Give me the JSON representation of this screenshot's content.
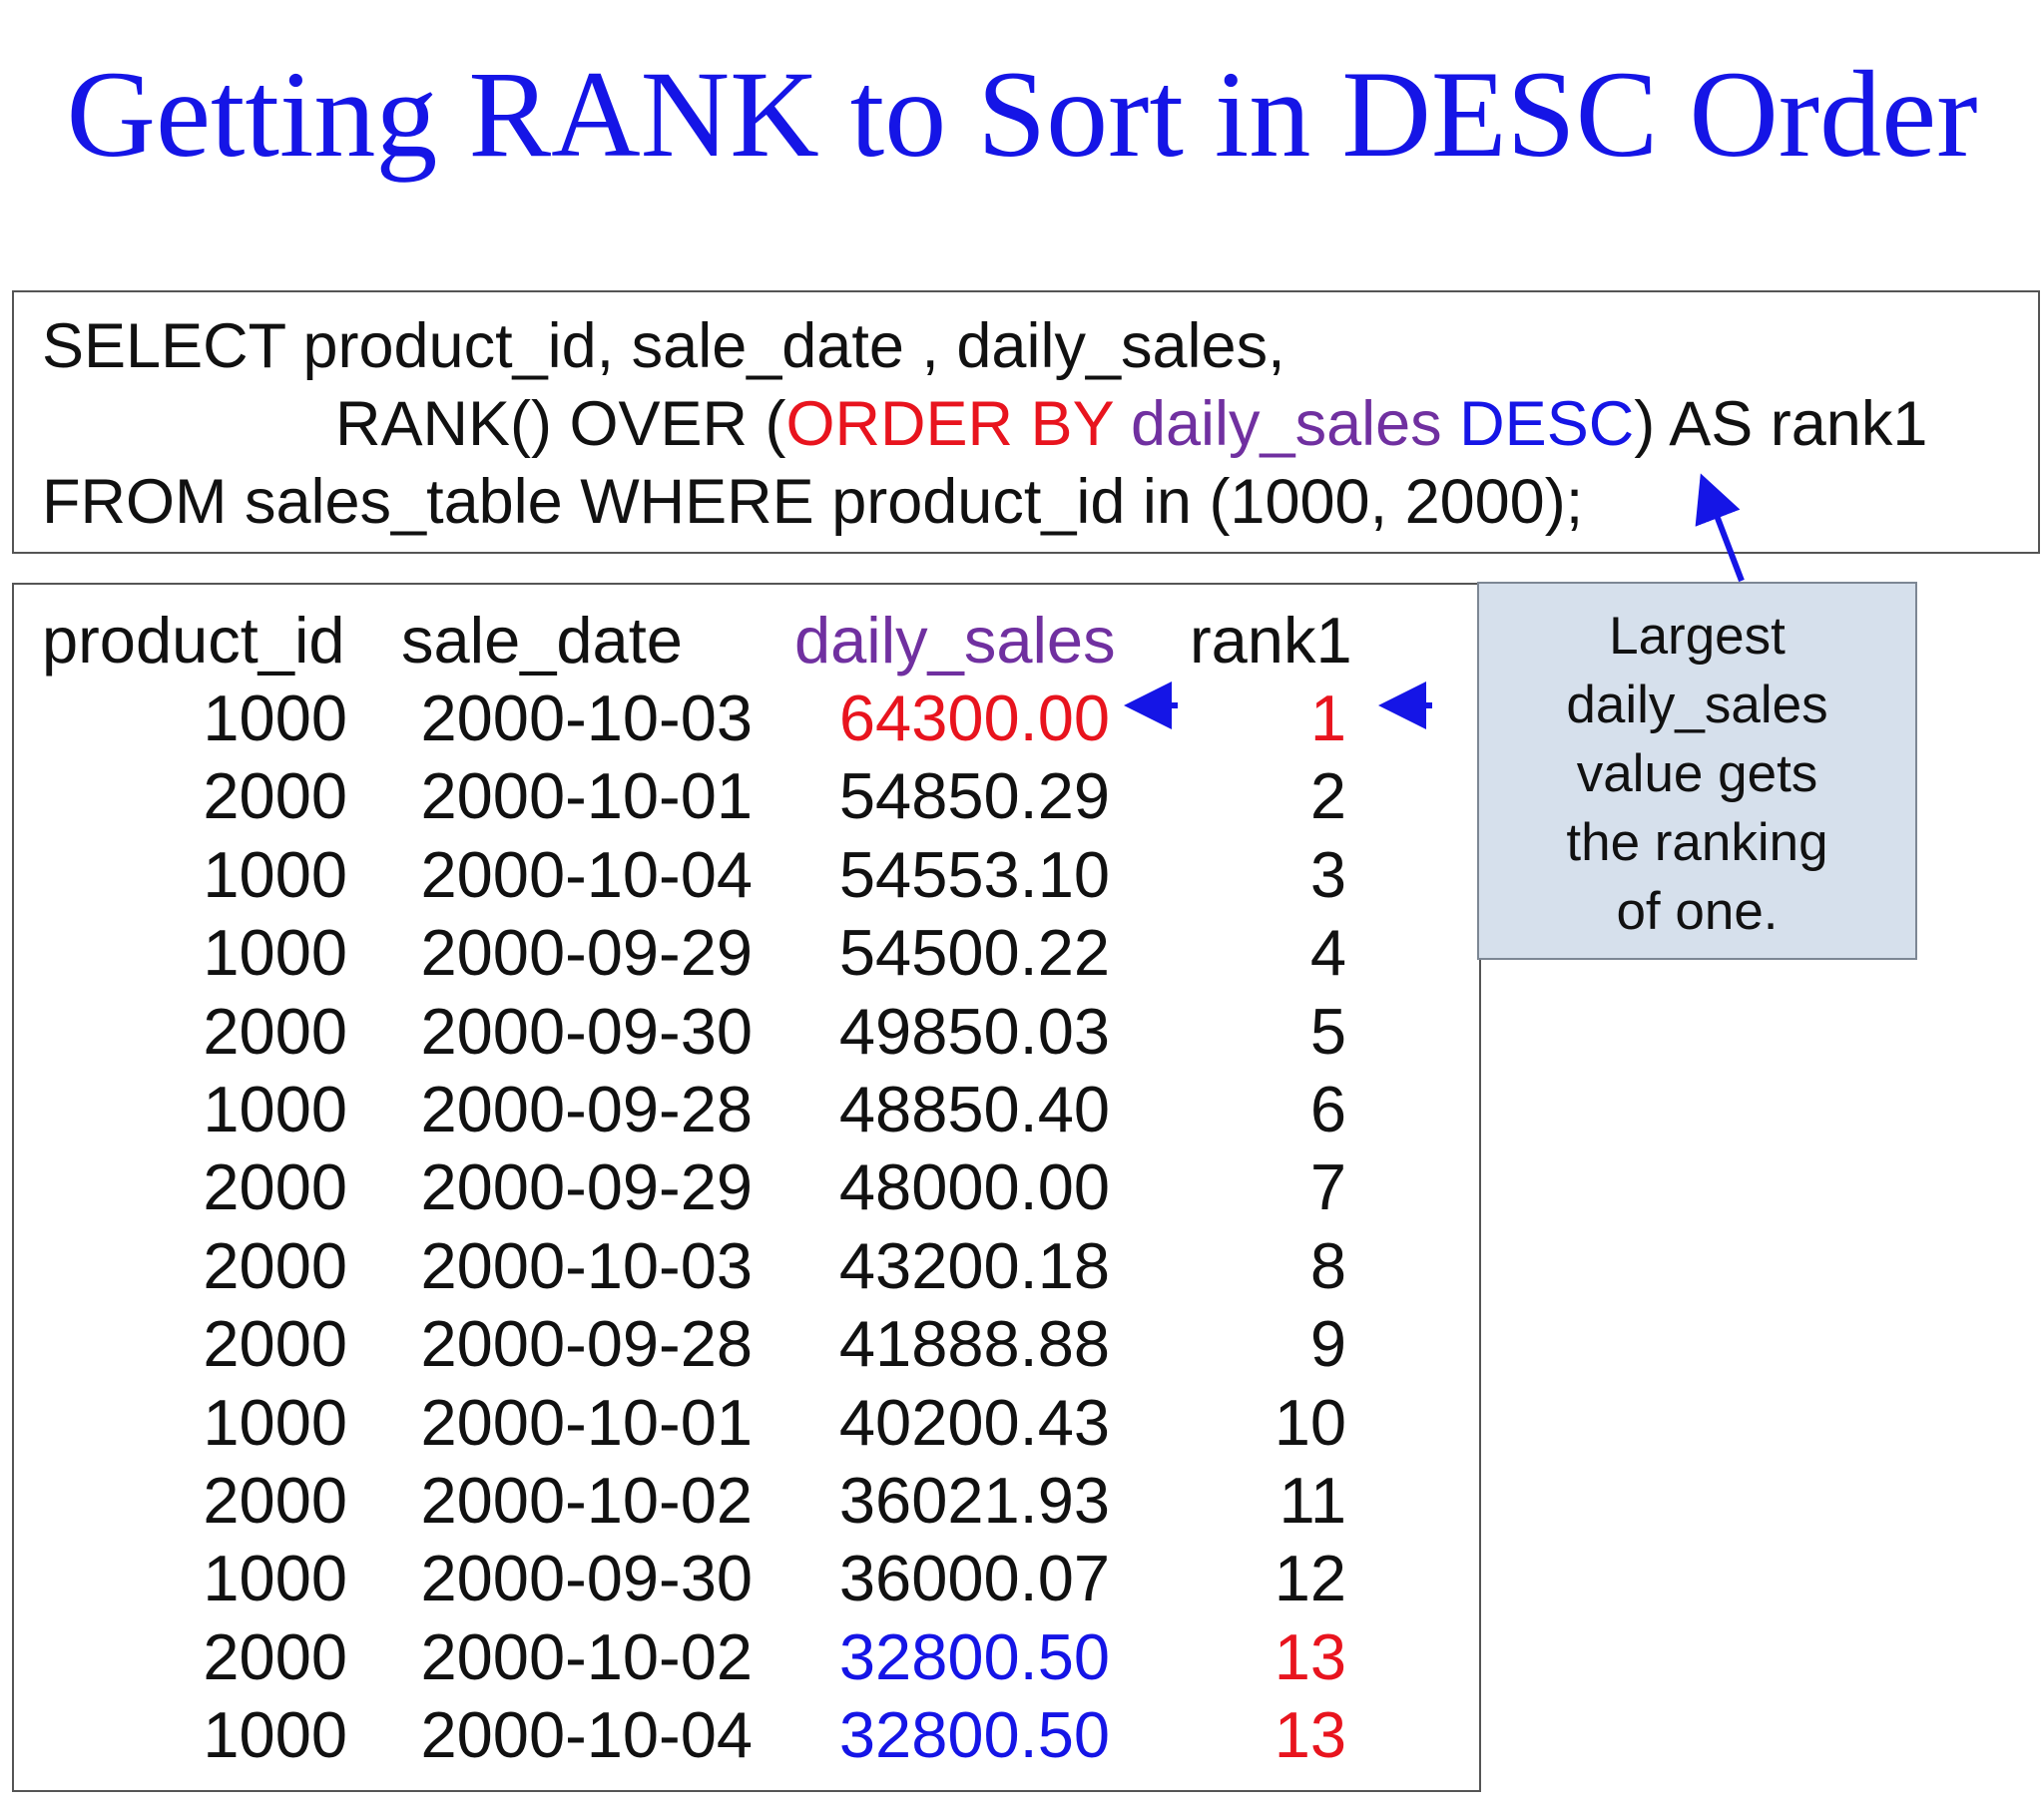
{
  "title": "Getting RANK to Sort in DESC Order",
  "colors": {
    "title": "#1515e6",
    "red": "#e8141e",
    "purple": "#7030a0",
    "blue": "#1515e6",
    "text": "#111111",
    "callout_bg": "#d6e0ec"
  },
  "sql": {
    "line1": "SELECT  product_id, sale_date , daily_sales,",
    "line2_prefix": "RANK()  OVER (",
    "line2_order_by": "ORDER BY",
    "line2_column": "daily_sales",
    "line2_desc": "DESC",
    "line2_suffix": ") AS rank1",
    "line3": "FROM   sales_table WHERE product_id in (1000, 2000);"
  },
  "table": {
    "headers": [
      "product_id",
      "sale_date",
      "daily_sales",
      "rank1"
    ],
    "rows": [
      {
        "product_id": "1000",
        "sale_date": "2000-10-03",
        "daily_sales": "64300.00",
        "rank1": "1",
        "sales_color": "red",
        "rank_color": "red"
      },
      {
        "product_id": "2000",
        "sale_date": "2000-10-01",
        "daily_sales": "54850.29",
        "rank1": "2",
        "sales_color": "text",
        "rank_color": "text"
      },
      {
        "product_id": "1000",
        "sale_date": "2000-10-04",
        "daily_sales": "54553.10",
        "rank1": "3",
        "sales_color": "text",
        "rank_color": "text"
      },
      {
        "product_id": "1000",
        "sale_date": "2000-09-29",
        "daily_sales": "54500.22",
        "rank1": "4",
        "sales_color": "text",
        "rank_color": "text"
      },
      {
        "product_id": "2000",
        "sale_date": "2000-09-30",
        "daily_sales": "49850.03",
        "rank1": "5",
        "sales_color": "text",
        "rank_color": "text"
      },
      {
        "product_id": "1000",
        "sale_date": "2000-09-28",
        "daily_sales": "48850.40",
        "rank1": "6",
        "sales_color": "text",
        "rank_color": "text"
      },
      {
        "product_id": "2000",
        "sale_date": "2000-09-29",
        "daily_sales": "48000.00",
        "rank1": "7",
        "sales_color": "text",
        "rank_color": "text"
      },
      {
        "product_id": "2000",
        "sale_date": "2000-10-03",
        "daily_sales": "43200.18",
        "rank1": "8",
        "sales_color": "text",
        "rank_color": "text"
      },
      {
        "product_id": "2000",
        "sale_date": "2000-09-28",
        "daily_sales": "41888.88",
        "rank1": "9",
        "sales_color": "text",
        "rank_color": "text"
      },
      {
        "product_id": "1000",
        "sale_date": "2000-10-01",
        "daily_sales": "40200.43",
        "rank1": "10",
        "sales_color": "text",
        "rank_color": "text"
      },
      {
        "product_id": "2000",
        "sale_date": "2000-10-02",
        "daily_sales": "36021.93",
        "rank1": "11",
        "sales_color": "text",
        "rank_color": "text"
      },
      {
        "product_id": "1000",
        "sale_date": "2000-09-30",
        "daily_sales": "36000.07",
        "rank1": "12",
        "sales_color": "text",
        "rank_color": "text"
      },
      {
        "product_id": "2000",
        "sale_date": "2000-10-02",
        "daily_sales": "32800.50",
        "rank1": "13",
        "sales_color": "blue",
        "rank_color": "red"
      },
      {
        "product_id": "1000",
        "sale_date": "2000-10-04",
        "daily_sales": "32800.50",
        "rank1": "13",
        "sales_color": "blue",
        "rank_color": "red"
      }
    ]
  },
  "callout": {
    "lines": [
      "Largest",
      "daily_sales",
      "value gets",
      "the ranking",
      "of one."
    ]
  },
  "icons": [
    "arrow-left-icon",
    "arrow-up-icon"
  ]
}
